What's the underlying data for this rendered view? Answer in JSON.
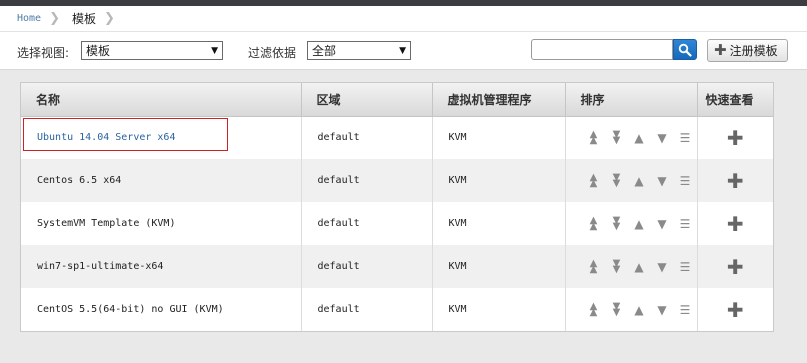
{
  "breadcrumb": {
    "home": "Home",
    "current": "模板"
  },
  "toolbar": {
    "view_label": "选择视图:",
    "view_value": "模板",
    "filter_label": "过滤依据",
    "filter_value": "全部",
    "search_value": "",
    "add_button_label": "注册模板"
  },
  "table": {
    "headers": [
      "名称",
      "区域",
      "虚拟机管理程序",
      "排序",
      "快速查看"
    ],
    "rows": [
      {
        "name": "Ubuntu 14.04 Server x64",
        "zone": "default",
        "hypervisor": "KVM"
      },
      {
        "name": "Centos 6.5 x64",
        "zone": "default",
        "hypervisor": "KVM"
      },
      {
        "name": "SystemVM Template (KVM)",
        "zone": "default",
        "hypervisor": "KVM"
      },
      {
        "name": "win7-sp1-ultimate-x64",
        "zone": "default",
        "hypervisor": "KVM"
      },
      {
        "name": "CentOS 5.5(64-bit) no GUI (KVM)",
        "zone": "default",
        "hypervisor": "KVM"
      }
    ]
  },
  "icons": {
    "order": [
      "move-top-icon",
      "move-bottom-icon",
      "move-up-icon",
      "move-down-icon",
      "drag-icon"
    ],
    "quickview": "plus-icon",
    "search": "search-icon",
    "add": "plus-icon"
  },
  "colors": {
    "link": "#2b63a0",
    "highlight": "#cc2222",
    "search_button": "#1f74c7"
  }
}
